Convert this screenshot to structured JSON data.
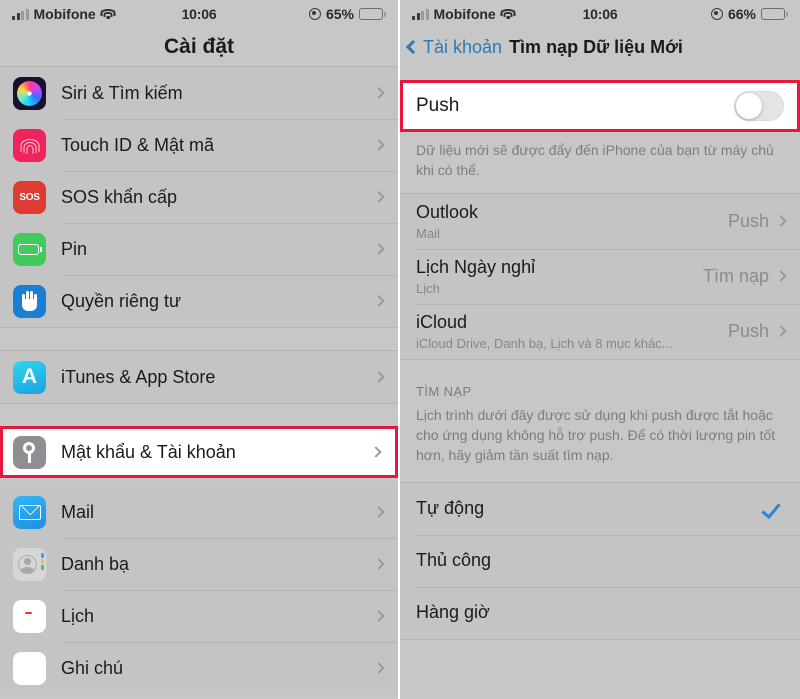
{
  "left": {
    "status": {
      "signal_icon": "signal-bars-icon",
      "carrier": "Mobifone",
      "wifi_icon": "wifi-icon",
      "time": "10:06",
      "location_icon": "location-services-icon",
      "battery": "65%",
      "battery_icon": "battery-icon"
    },
    "title": "Cài đặt",
    "groups": [
      {
        "items": [
          {
            "label": "Siri & Tìm kiếm",
            "icon": "siri-icon"
          },
          {
            "label": "Touch ID & Mật mã",
            "icon": "touch-id-icon"
          },
          {
            "label": "SOS khẩn cấp",
            "icon": "sos-icon",
            "icon_text": "SOS"
          },
          {
            "label": "Pin",
            "icon": "battery-settings-icon"
          },
          {
            "label": "Quyền riêng tư",
            "icon": "privacy-hand-icon"
          }
        ]
      },
      {
        "items": [
          {
            "label": "iTunes & App Store",
            "icon": "app-store-icon",
            "icon_text": "A"
          }
        ]
      },
      {
        "items": [
          {
            "label": "Mật khẩu & Tài khoản",
            "icon": "key-icon",
            "highlighted": true
          }
        ]
      },
      {
        "items": [
          {
            "label": "Mail",
            "icon": "mail-icon"
          },
          {
            "label": "Danh bạ",
            "icon": "contacts-icon"
          },
          {
            "label": "Lịch",
            "icon": "calendar-icon"
          },
          {
            "label": "Ghi chú",
            "icon": "notes-icon"
          }
        ]
      }
    ]
  },
  "right": {
    "status": {
      "signal_icon": "signal-bars-icon",
      "carrier": "Mobifone",
      "wifi_icon": "wifi-icon",
      "time": "10:06",
      "location_icon": "location-services-icon",
      "battery": "66%",
      "battery_icon": "battery-icon"
    },
    "back_label": "Tài khoản",
    "back_icon": "chevron-left-icon",
    "title": "Tìm nạp Dữ liệu Mới",
    "push": {
      "label": "Push",
      "toggle_state": "off",
      "footnote": "Dữ liệu mới sẽ được đẩy đến iPhone của bạn từ máy chủ khi có thể."
    },
    "accounts": [
      {
        "title": "Outlook",
        "subtitle": "Mail",
        "value": "Push"
      },
      {
        "title": "Lịch Ngày nghỉ",
        "subtitle": "Lịch",
        "value": "Tìm nạp"
      },
      {
        "title": "iCloud",
        "subtitle": "iCloud Drive, Danh bạ, Lịch và 8 mục khác...",
        "value": "Push"
      }
    ],
    "fetch_section": {
      "header": "TÌM NẠP",
      "note": "Lịch trình dưới đây được sử dụng khi push được tắt hoặc cho ứng dụng không hỗ trợ push. Để có thời lượng pin tốt hơn, hãy giảm tần suất tìm nạp.",
      "options": [
        {
          "label": "Tự động",
          "selected": true
        },
        {
          "label": "Thủ công",
          "selected": false
        },
        {
          "label": "Hàng giờ",
          "selected": false
        }
      ]
    }
  },
  "colors": {
    "accent_blue": "#2a7ab8",
    "highlight_red": "#e8173d",
    "background_gray": "#c7c7c7"
  }
}
